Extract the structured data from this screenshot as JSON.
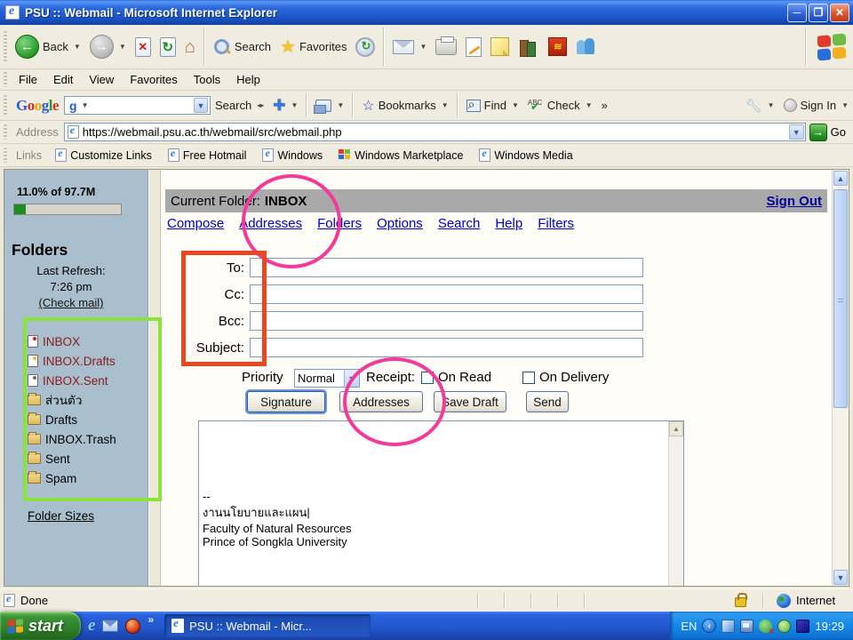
{
  "window": {
    "title": "PSU :: Webmail - Microsoft Internet Explorer"
  },
  "toolbar": {
    "back": "Back",
    "search": "Search",
    "favorites": "Favorites"
  },
  "menu": {
    "items": [
      "File",
      "Edit",
      "View",
      "Favorites",
      "Tools",
      "Help"
    ]
  },
  "google_bar": {
    "logo_letters": [
      "G",
      "o",
      "o",
      "g",
      "l",
      "e"
    ],
    "search_value": "",
    "search_label": "Search",
    "bookmarks": "Bookmarks",
    "find": "Find",
    "check": "Check",
    "overflow": "»",
    "sign_in": "Sign In"
  },
  "address_bar": {
    "label": "Address",
    "url": "https://webmail.psu.ac.th/webmail/src/webmail.php",
    "go": "Go"
  },
  "links_bar": {
    "label": "Links",
    "items": [
      "Customize Links",
      "Free Hotmail",
      "Windows",
      "Windows Marketplace",
      "Windows Media"
    ]
  },
  "webmail": {
    "sidebar": {
      "quota": "11.0% of 97.7M",
      "quota_percent": 11,
      "heading": "Folders",
      "last_refresh_label": "Last Refresh:",
      "last_refresh_time": "7:26 pm",
      "check_mail": "(Check mail)",
      "folders": [
        {
          "label": "INBOX"
        },
        {
          "label": "INBOX.Drafts"
        },
        {
          "label": "INBOX.Sent"
        },
        {
          "label": "ส่วนตัว"
        },
        {
          "label": "Drafts"
        },
        {
          "label": "INBOX.Trash"
        },
        {
          "label": "Sent"
        },
        {
          "label": "Spam"
        }
      ],
      "folder_sizes": "Folder Sizes"
    },
    "header": {
      "current_folder_label": "Current Folder:",
      "current_folder": "INBOX",
      "sign_out": "Sign Out"
    },
    "nav": {
      "items": [
        "Compose",
        "Addresses",
        "Folders",
        "Options",
        "Search",
        "Help",
        "Filters"
      ]
    },
    "compose": {
      "to_label": "To:",
      "cc_label": "Cc:",
      "bcc_label": "Bcc:",
      "subject_label": "Subject:",
      "to_value": "",
      "cc_value": "",
      "bcc_value": "",
      "subject_value": "",
      "priority_label": "Priority",
      "priority_value": "Normal",
      "receipt_label": "Receipt:",
      "on_read_label": "On Read",
      "on_delivery_label": "On Delivery",
      "signature_button": "Signature",
      "addresses_button": "Addresses",
      "save_draft_button": "Save Draft",
      "send_button": "Send",
      "body": "\n\n\n\n\n--\nงานนโยบายและแผน|\nFaculty of Natural Resources\nPrince of Songkla University"
    }
  },
  "status_bar": {
    "status": "Done",
    "zone": "Internet"
  },
  "taskbar": {
    "start": "start",
    "overflow": "»",
    "task": "PSU :: Webmail - Micr...",
    "lang": "EN",
    "time": "19:29"
  },
  "annotations": {
    "pink": "#f23a9b",
    "orange": "#e8481f",
    "green": "#8ae23c"
  }
}
